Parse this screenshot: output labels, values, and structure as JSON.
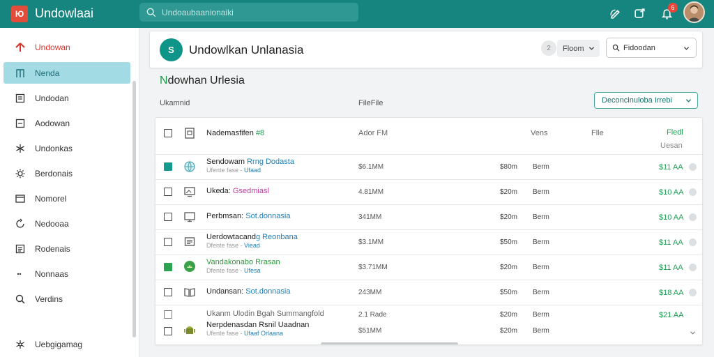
{
  "app": {
    "logo_text": "Ю",
    "title": "Undowlaai"
  },
  "search": {
    "placeholder": "Undoaubaanionaiki"
  },
  "topbar": {
    "badge": "6"
  },
  "sidebar": {
    "items": [
      {
        "label": "Undowan",
        "icon": "upload-icon"
      },
      {
        "label": "Nenda",
        "icon": "home-icon"
      },
      {
        "label": "Undodan",
        "icon": "document-icon"
      },
      {
        "label": "Aodowan",
        "icon": "folder-icon"
      },
      {
        "label": "Undonkas",
        "icon": "asterisk-icon"
      },
      {
        "label": "Berdonais",
        "icon": "gear-icon"
      },
      {
        "label": "Nomorel",
        "icon": "inbox-icon"
      },
      {
        "label": "Nedooaa",
        "icon": "refresh-icon"
      },
      {
        "label": "Rodenais",
        "icon": "list-icon"
      },
      {
        "label": "Nonnaas",
        "icon": "dots-icon"
      },
      {
        "label": "Verdins",
        "icon": "search-icon"
      },
      {
        "label": "Uebgigamag",
        "icon": "settings-icon"
      }
    ]
  },
  "header": {
    "icon_letter": "S",
    "title": "Undowlkan Unlanasia",
    "circle_label": "2",
    "filter_label": "Floom",
    "select_label": "Fidoodan"
  },
  "section": {
    "title_first": "N",
    "title_rest": "dowhan Urlesia",
    "meta_left": "Ukamnid",
    "meta_mid": "FileFile",
    "select_label": "Deconcinuloba Irrebi"
  },
  "table": {
    "headers": {
      "name": "Nademasfifen",
      "name_tag": "#8",
      "size": "Ador FM",
      "date": "Vens",
      "status": "Flle",
      "price": "Fledl",
      "price_sub": "Uesan"
    },
    "rows": [
      {
        "name": "Sendowam ",
        "name_hl": "Rrng Dodasta",
        "sub": "Ufente fase - ",
        "sub_hl": "Ufaad",
        "size": "$6.1MM",
        "date": "$80m",
        "status": "Berm",
        "price": "$11 AA"
      },
      {
        "name": "Ukeda: ",
        "name_hl": "Gsedmiasl",
        "sub": "",
        "sub_hl": "",
        "size": "4.81MM",
        "date": "$20m",
        "status": "Berm",
        "price": "$10 AA"
      },
      {
        "name": "Perbmsan: ",
        "name_hl": "Sot.donnasia",
        "sub": "",
        "sub_hl": "",
        "size": "341MM",
        "date": "$20m",
        "status": "Berm",
        "price": "$10 AA"
      },
      {
        "name": "Uerdowtacand",
        "name_hl": "g Reonbana",
        "sub": "Dfente fase - ",
        "sub_hl": "Viead",
        "size": "$3.1MM",
        "date": "$50m",
        "status": "Berm",
        "price": "$11 AA"
      },
      {
        "name": "Vandakonabo Rrasan",
        "name_hl": "",
        "sub": "Dfente fase - ",
        "sub_hl": "Ufesa",
        "size": "$3.71MM",
        "date": "$20m",
        "status": "Berm",
        "price": "$11 AA"
      },
      {
        "name": "Undansan: ",
        "name_hl": "Sot.donnasia",
        "sub": "",
        "sub_hl": "",
        "size": "243MM",
        "date": "$50m",
        "status": "Berm",
        "price": "$18 AA"
      },
      {
        "name": "Ukanm Ulodin",
        "name_hl": " Bgah Summangfold",
        "sub": "",
        "sub_hl": "",
        "size": "2.1 Rade",
        "date": "$20m",
        "status": "Berm",
        "price": "$21 AA"
      },
      {
        "name": "Nerpdenasdan Rsnil Uaadnan",
        "name_hl": "",
        "sub": "Ufente fase - ",
        "sub_hl": "Ufaaf Orlaana",
        "size": "$51MM",
        "date": "$20m",
        "status": "Berm",
        "price": ""
      }
    ]
  }
}
